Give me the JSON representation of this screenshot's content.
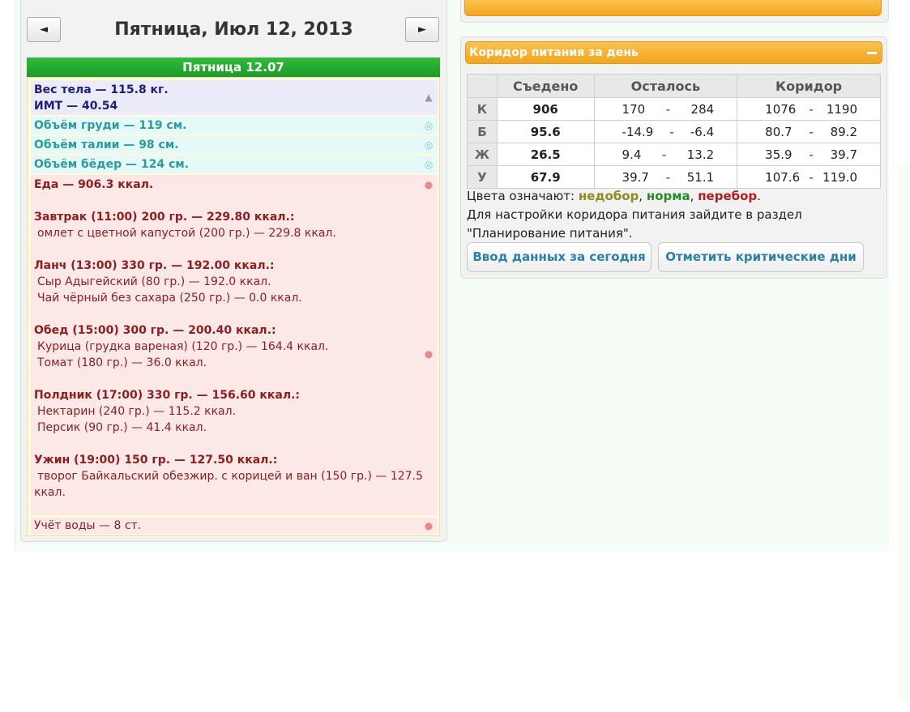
{
  "nav": {
    "prev": "◄",
    "next": "►",
    "date_title": "Пятница, Июл 12, 2013"
  },
  "day_bar": "Пятница 12.07",
  "entries": {
    "weight": {
      "line1": "Вес тела — 115.8 кг.",
      "line2": "ИМТ — 40.54"
    },
    "chest": "Объём груди — 119 см.",
    "waist": "Объём талии — 98 см.",
    "hips": "Объём бёдер — 124 см.",
    "food": {
      "total": "Еда — 906.3 ккал.",
      "meals": [
        {
          "header": "Завтрак (11:00) 200 гр. — 229.80 ккал.:",
          "items": [
            "омлет с цветной капустой (200 гр.) — 229.8 ккал."
          ]
        },
        {
          "header": "Ланч (13:00) 330 гр. — 192.00 ккал.:",
          "items": [
            "Сыр Адыгейский (80 гр.) — 192.0 ккал.",
            "Чай чёрный без сахара (250 гр.) — 0.0 ккал."
          ]
        },
        {
          "header": "Обед (15:00) 300 гр. — 200.40 ккал.:",
          "items": [
            "Курица (грудка вареная) (120 гр.) — 164.4 ккал.",
            "Томат (180 гр.) — 36.0 ккал."
          ]
        },
        {
          "header": "Полдник (17:00) 330 гр. — 156.60 ккал.:",
          "items": [
            "Нектарин (240 гр.) — 115.2 ккал.",
            "Персик (90 гр.) — 41.4 ккал."
          ]
        },
        {
          "header": "Ужин (19:00) 150 гр. — 127.50 ккал.:",
          "items": [
            "творог Байкальский обезжир. с корицей и ван (150 гр.) — 127.5",
            "ккал."
          ]
        }
      ]
    },
    "water": "Учёт воды — 8 ст."
  },
  "corridor": {
    "title": "Коридор питания за день",
    "headers": [
      "",
      "Съедено",
      "Осталось",
      "Коридор"
    ],
    "rows": [
      {
        "label": "К",
        "eaten": "906",
        "status": "under",
        "left_min": "170",
        "left_max": "284",
        "cor_min": "1076",
        "cor_max": "1190"
      },
      {
        "label": "Б",
        "eaten": "95.6",
        "status": "over",
        "left_min": "-14.9",
        "left_max": "-6.4",
        "cor_min": "80.7",
        "cor_max": "89.2"
      },
      {
        "label": "Ж",
        "eaten": "26.5",
        "status": "under",
        "left_min": "9.4",
        "left_max": "13.2",
        "cor_min": "35.9",
        "cor_max": "39.7"
      },
      {
        "label": "У",
        "eaten": "67.9",
        "status": "under",
        "left_min": "39.7",
        "left_max": "51.1",
        "cor_min": "107.6",
        "cor_max": "119.0"
      }
    ],
    "dash": "-",
    "legend_prefix": "Цвета означают: ",
    "legend_under": "недобор",
    "legend_norm": "норма",
    "legend_over": "перебор",
    "legend_sep": ", ",
    "legend_end": ".",
    "note_line1": "Для настройки коридора питания зайдите в раздел",
    "note_line2": "\"Планирование питания\".",
    "btn_today": "Ввод данных за сегодня",
    "btn_critical": "Отметить критические дни"
  },
  "colors": {
    "under": "#8c8c1e",
    "norm": "#2a8a2a",
    "over": "#b01c1c",
    "header_orange": "#f2a51e",
    "day_green": "#1f9a29"
  },
  "icons": {
    "weight": "weight-icon",
    "measure": "measure-icon",
    "food": "apple-icon",
    "water": "drop-icon"
  }
}
